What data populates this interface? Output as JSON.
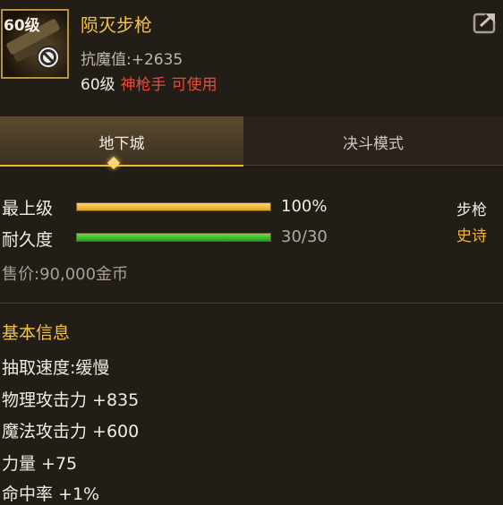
{
  "item": {
    "level_tag": "60级",
    "name": "陨灭步枪",
    "resist_label": "抗魔值:",
    "resist_value": "+2635",
    "required_level": "60级",
    "required_class": "神枪手",
    "usable": "可使用",
    "icon": "rifle-icon",
    "badge_icon": "no-trade-icon",
    "share_icon": "share-icon"
  },
  "tabs": [
    {
      "label": "地下城",
      "active": true
    },
    {
      "label": "决斗模式",
      "active": false
    }
  ],
  "stats": {
    "grade_label": "最上级",
    "grade_percent": "100%",
    "grade_fill": 1.0,
    "durability_label": "耐久度",
    "durability_value": "30/30",
    "durability_fill": 1.0,
    "weapon_type": "步枪",
    "rarity": "史诗",
    "price_label": "售价:",
    "price_value": "90,000金币"
  },
  "basic_info": {
    "title": "基本信息",
    "lines": [
      "抽取速度:缓慢",
      "物理攻击力 +835",
      "魔法攻击力 +600",
      "力量 +75",
      "命中率 +1%"
    ]
  },
  "colors": {
    "name": "#f2c247",
    "required_class": "#ea4a3b",
    "rarity": "#f0b52f",
    "grade_bar": "#e0a31f",
    "durability_bar": "#3fbf2e",
    "tab_underline": "#f0b830"
  }
}
